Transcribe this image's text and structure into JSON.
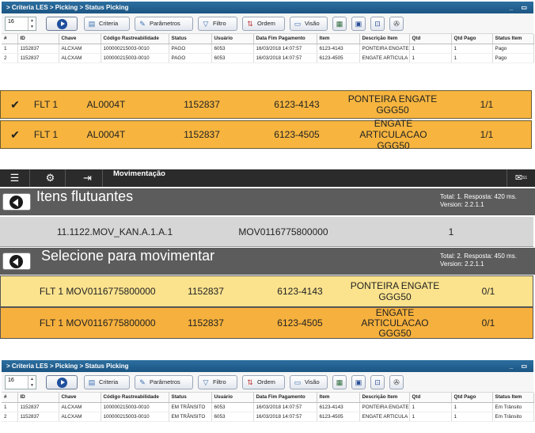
{
  "panel1": {
    "breadcrumb": "> Criteria LES > Picking > Status Picking",
    "window_controls": "_ ▭",
    "page_size": "16",
    "toolbar": {
      "criteria": "Criteria",
      "parametros": "Parâmetros",
      "filtro": "Filtro",
      "ordem": "Ordem",
      "visao": "Visão"
    },
    "columns": [
      "#",
      "ID",
      "Chave",
      "Código Rastreabilidade",
      "Status",
      "Usuário",
      "Data Fim Pagamento",
      "Item",
      "Descrição Item",
      "Qtd",
      "Qtd Pago",
      "Status Item"
    ],
    "rows": [
      [
        "1",
        "1152837",
        "ALCXAM",
        "100000215003-0010",
        "PAGO",
        "6053",
        "16/03/2018 14:07:57",
        "6123-4143",
        "PONTEIRA ENGATE",
        "1",
        "1",
        "Pago"
      ],
      [
        "2",
        "1152837",
        "ALCXAM",
        "100000215003-0010",
        "PAGO",
        "6053",
        "16/03/2018 14:07:57",
        "6123-4505",
        "ENGATE ARTICULA",
        "1",
        "1",
        "Pago"
      ]
    ]
  },
  "scanner_rows": [
    {
      "check": "✔",
      "flt": "FLT 1",
      "key": "AL0004T",
      "id": "1152837",
      "item": "6123-4143",
      "desc": "PONTEIRA ENGATE GGG50",
      "qty": "1/1"
    },
    {
      "check": "✔",
      "flt": "FLT 1",
      "key": "AL0004T",
      "id": "1152837",
      "item": "6123-4505",
      "desc": "ENGATE ARTICULACAO GGG50",
      "qty": "1/1"
    }
  ],
  "app": {
    "title": "Movimentação",
    "menu_icon": "☰",
    "settings_icon": "⚙",
    "logout_icon": "⇥",
    "mail_icon": "✉",
    "mail_badge": "S1",
    "section1": {
      "title": "Itens flutuantes",
      "total": "Total: 1. Resposta: 420 ms.",
      "version": "Version: 2.2.1.1"
    },
    "floating_item": {
      "location": "11.1122.MOV_KAN.A.1.A.1",
      "mov": "MOV0116775800000",
      "qty": "1"
    },
    "section2": {
      "title": "Selecione para movimentar",
      "total": "Total: 2. Resposta: 450 ms.",
      "version": "Version: 2.2.1.1"
    },
    "move_rows": [
      {
        "flt": "FLT 1",
        "mov": "MOV0116775800000",
        "id": "1152837",
        "item": "6123-4143",
        "desc": "PONTEIRA ENGATE GGG50",
        "qty": "0/1"
      },
      {
        "flt": "FLT 1",
        "mov": "MOV0116775800000",
        "id": "1152837",
        "item": "6123-4505",
        "desc": "ENGATE ARTICULACAO GGG50",
        "qty": "0/1"
      }
    ]
  },
  "panel2": {
    "breadcrumb": "> Criteria LES > Picking > Status Picking",
    "window_controls": "_ ▭",
    "page_size": "16",
    "toolbar": {
      "criteria": "Criteria",
      "parametros": "Parâmetros",
      "filtro": "Filtro",
      "ordem": "Ordem",
      "visao": "Visão"
    },
    "columns": [
      "#",
      "ID",
      "Chave",
      "Código Rastreabilidade",
      "Status",
      "Usuário",
      "Data Fim Pagamento",
      "Item",
      "Descrição Item",
      "Qtd",
      "Qtd Pago",
      "Status Item"
    ],
    "rows": [
      [
        "1",
        "1152837",
        "ALCXAM",
        "100000215003-0010",
        "EM TRÂNSITO",
        "6053",
        "16/03/2018 14:07:57",
        "6123-4143",
        "PONTEIRA ENGATE",
        "1",
        "1",
        "Em Trânsito"
      ],
      [
        "2",
        "1152837",
        "ALCXAM",
        "100000215003-0010",
        "EM TRÂNSITO",
        "6053",
        "16/03/2018 14:07:57",
        "6123-4505",
        "ENGATE ARTICULA",
        "1",
        "1",
        "Em Trânsito"
      ]
    ]
  }
}
